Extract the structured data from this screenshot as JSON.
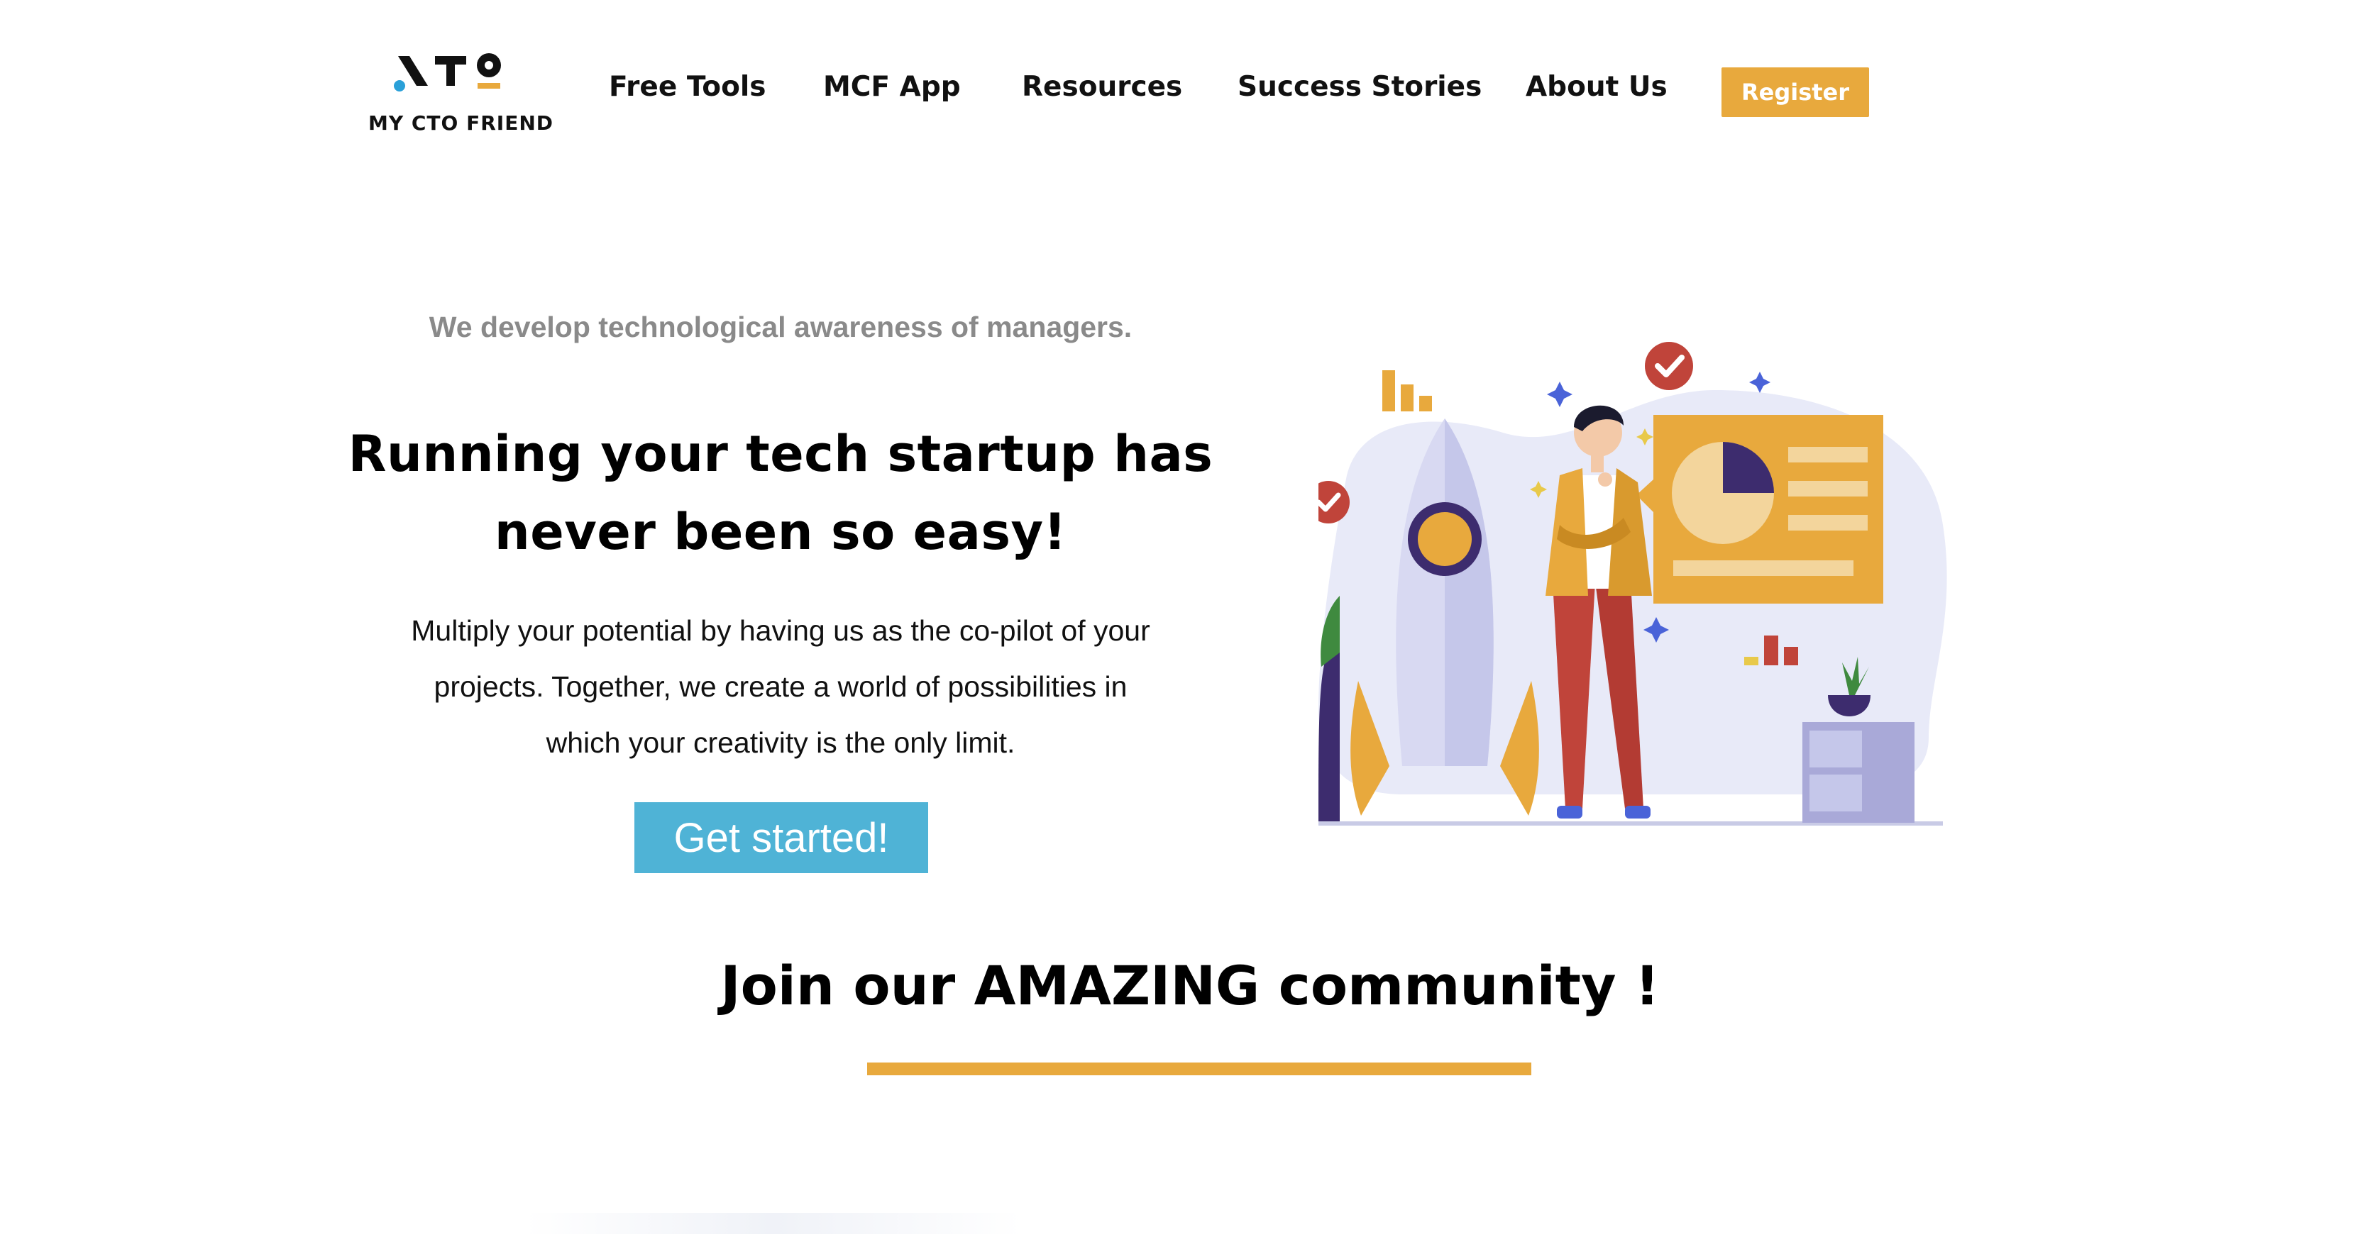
{
  "header": {
    "logo_text": "MY CTO FRIEND",
    "nav": [
      {
        "label": "Free Tools"
      },
      {
        "label": "MCF App"
      },
      {
        "label": "Resources"
      },
      {
        "label": "Success Stories"
      },
      {
        "label": "About Us"
      }
    ],
    "register_label": "Register"
  },
  "hero": {
    "tagline": "We develop technological awareness of managers.",
    "title_line1": "Running your tech startup has",
    "title_line2": "never been so easy!",
    "text_line1": "Multiply your potential by having us as the co-pilot of your",
    "text_line2": "projects. Together, we create a world of possibilities in",
    "text_line3": "which your creativity is the only limit.",
    "cta_label": "Get started!"
  },
  "community": {
    "title": "Join our AMAZING community !"
  },
  "colors": {
    "accent": "#e8a93d",
    "cta": "#4fb3d6",
    "tagline": "#8a8a8a",
    "logo_blue": "#2aa0d8",
    "logo_orange": "#e8a93d"
  },
  "icons": [
    "rocket-illustration",
    "person-illustration",
    "presentation-board-illustration",
    "check-badge-icon",
    "plant-icon",
    "sparkle-icon"
  ]
}
